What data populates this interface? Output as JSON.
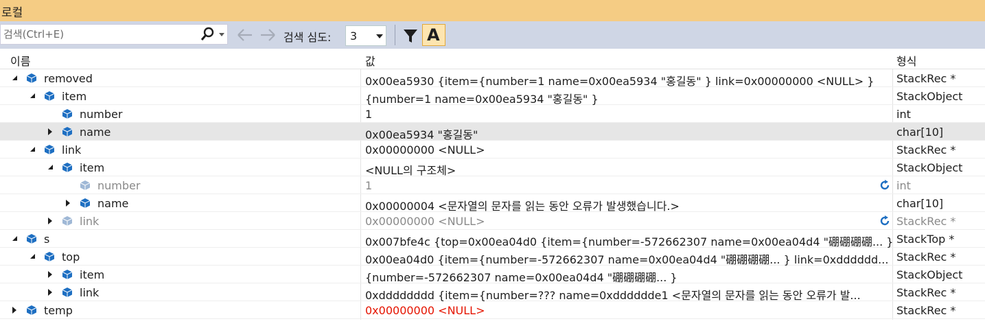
{
  "title": "로컬",
  "toolbar": {
    "search_placeholder": "검색(Ctrl+E)",
    "depth_label": "검색 심도:",
    "depth_value": "3",
    "font_toggle_label": "A"
  },
  "columns": {
    "name": "이름",
    "value": "값",
    "type": "형식"
  },
  "rows": [
    {
      "name": "removed",
      "value": "0x00ea5930 {item={number=1 name=0x00ea5934 \"홍길동\" } link=0x00000000 <NULL> }",
      "type": "StackRec *"
    },
    {
      "name": "item",
      "value": "{number=1 name=0x00ea5934 \"홍길동\" }",
      "type": "StackObject"
    },
    {
      "name": "number",
      "value": "1",
      "type": "int"
    },
    {
      "name": "name",
      "value": "0x00ea5934 \"홍길동\"",
      "type": "char[10]"
    },
    {
      "name": "link",
      "value": "0x00000000 <NULL>",
      "type": "StackRec *"
    },
    {
      "name": "item",
      "value": "<NULL의 구조체>",
      "type": "StackObject"
    },
    {
      "name": "number",
      "value": "1",
      "type": "int"
    },
    {
      "name": "name",
      "value": "0x00000004 <문자열의 문자를 읽는 동안 오류가 발생했습니다.>",
      "type": "char[10]"
    },
    {
      "name": "link",
      "value": "0x00000000 <NULL>",
      "type": "StackRec *"
    },
    {
      "name": "s",
      "value": "0x007bfe4c {top=0x00ea04d0 {item={number=-572662307 name=0x00ea04d4 \"硼硼硼硼... }...",
      "type": "StackTop *"
    },
    {
      "name": "top",
      "value": "0x00ea04d0 {item={number=-572662307 name=0x00ea04d4 \"硼硼硼硼... } link=0xdddddd...",
      "type": "StackRec *"
    },
    {
      "name": "item",
      "value": "{number=-572662307 name=0x00ea04d4 \"硼硼硼硼... }",
      "type": "StackObject"
    },
    {
      "name": "link",
      "value": "0xdddddddd {item={number=??? name=0xdddddde1 <문자열의 문자를 읽는 동안 오류가 발...",
      "type": "StackRec *"
    },
    {
      "name": "temp",
      "value": "0x00000000 <NULL>",
      "type": "StackRec *"
    }
  ]
}
